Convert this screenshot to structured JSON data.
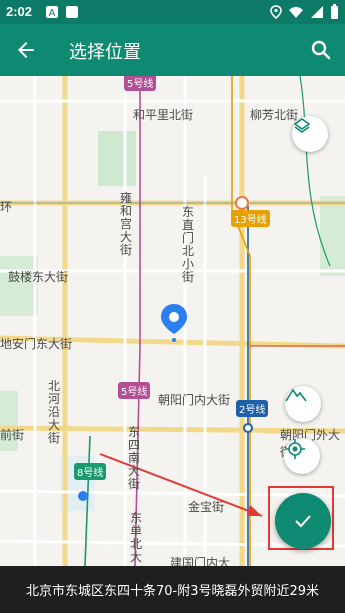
{
  "status_bar": {
    "time": "2:02",
    "icons": [
      "notification-a-icon",
      "notification-square-icon",
      "location-icon",
      "wifi-icon",
      "signal-icon",
      "battery-icon"
    ]
  },
  "app_bar": {
    "title": "选择位置",
    "back_icon": "arrow-left-icon",
    "search_icon": "search-icon"
  },
  "map": {
    "metro_badges": [
      "5号线",
      "13号线",
      "5号线",
      "2号线",
      "8号线"
    ],
    "streets": {
      "heping_li_bei": "和平里北街",
      "liufang_bei": "柳芳北街",
      "huan": "环",
      "yonghegong": "雍和宫大街",
      "dongzhimen_bei_xiao": "东直门北小街",
      "gulou_dong": "鼓楼东大街",
      "dianmen": "地安门东大街",
      "beiheyan": "北河沿大街",
      "chaoyangmen_nei": "朝阳门内大街",
      "chaoyangmen_wai": "朝阳门外大街",
      "dongsi_nan": "东四南大街",
      "dongdan_bei": "东单北大",
      "jinbao": "金宝街",
      "jianguomen": "建国门内大",
      "qian": "前街"
    },
    "colors": {
      "route_line_5": "#b34f95",
      "route_line_2": "#1f5fa8",
      "route_line_8": "#1a9a6d",
      "route_line_13": "#e6a100",
      "confirm_button": "#0f8a72",
      "highlight_box": "#e53935",
      "pin": "#2b7ff0"
    }
  },
  "controls": {
    "layers": "layers-icon",
    "terrain": "terrain-icon",
    "locate": "my-location-icon",
    "confirm": "check-icon"
  },
  "address_bar": {
    "text": "北京市东城区东四十条70-附3号晓磊外贸附近29米"
  }
}
